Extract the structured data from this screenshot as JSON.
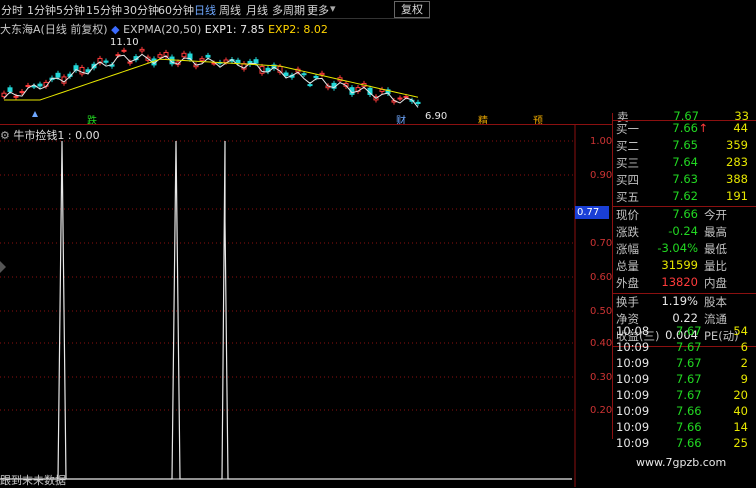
{
  "toolbar": {
    "items": [
      "分时",
      "1分钟",
      "5分钟",
      "15分钟",
      "30分钟",
      "60分钟",
      "日线",
      "周线",
      "月线",
      "多周期",
      "更多"
    ],
    "active_index": 6,
    "restore_label": "复权"
  },
  "main_chart": {
    "stock_name": "大东海A(日线 前复权)",
    "indicator_name": "EXPMA(20,50)",
    "exp1_label": "EXP1: 7.85",
    "exp2_label": "EXP2: 8.02",
    "high_label": "11.10",
    "low_label": "6.90",
    "signals": [
      "跌",
      "财",
      "精",
      "预"
    ]
  },
  "indicator_pane": {
    "legend": "牛市捡钱1 : 0.00",
    "y_ticks": [
      "1.00",
      "0.90",
      "0.80",
      "0.70",
      "0.60",
      "0.50",
      "0.40",
      "0.30",
      "0.20"
    ],
    "current_value_pill": "0.77"
  },
  "quote_panel": {
    "partial_top": {
      "label": "卖",
      "price": "7.67",
      "vol": "33"
    },
    "bids": [
      {
        "label": "买一",
        "price": "7.66",
        "vol": "44",
        "arrow": "↑"
      },
      {
        "label": "买二",
        "price": "7.65",
        "vol": "359"
      },
      {
        "label": "买三",
        "price": "7.64",
        "vol": "283"
      },
      {
        "label": "买四",
        "price": "7.63",
        "vol": "388"
      },
      {
        "label": "买五",
        "price": "7.62",
        "vol": "191"
      }
    ],
    "stats_left": [
      {
        "label": "现价",
        "value": "7.66",
        "color": "green"
      },
      {
        "label": "涨跌",
        "value": "-0.24",
        "color": "green"
      },
      {
        "label": "涨幅",
        "value": "-3.04%",
        "color": "green"
      },
      {
        "label": "总量",
        "value": "31599",
        "color": "yellow"
      },
      {
        "label": "外盘",
        "value": "13820",
        "color": "red"
      }
    ],
    "stats_right": [
      "今开",
      "最高",
      "最低",
      "量比",
      "内盘"
    ],
    "stats2": [
      {
        "label": "换手",
        "value": "1.19%",
        "right": "股本"
      },
      {
        "label": "净资",
        "value": "0.22",
        "right": "流通"
      },
      {
        "label": "收益(三)",
        "value": "0.004",
        "right": "PE(动)"
      }
    ],
    "ticks": [
      {
        "time": "10:08",
        "price": "7.67",
        "vol": "54"
      },
      {
        "time": "10:09",
        "price": "7.67",
        "vol": "6"
      },
      {
        "time": "10:09",
        "price": "7.67",
        "vol": "2"
      },
      {
        "time": "10:09",
        "price": "7.67",
        "vol": "9"
      },
      {
        "time": "10:09",
        "price": "7.67",
        "vol": "20"
      },
      {
        "time": "10:09",
        "price": "7.66",
        "vol": "40"
      },
      {
        "time": "10:09",
        "price": "7.66",
        "vol": "14"
      },
      {
        "time": "10:09",
        "price": "7.66",
        "vol": "25"
      }
    ]
  },
  "watermark": "www.7gpzb.com",
  "bottom_text": "跟到末未数据",
  "colors": {
    "up": "#ff3b3b",
    "down": "#22d822",
    "grid": "#8b1010",
    "yellow": "#e6e600",
    "pill": "#1a3fd6"
  }
}
